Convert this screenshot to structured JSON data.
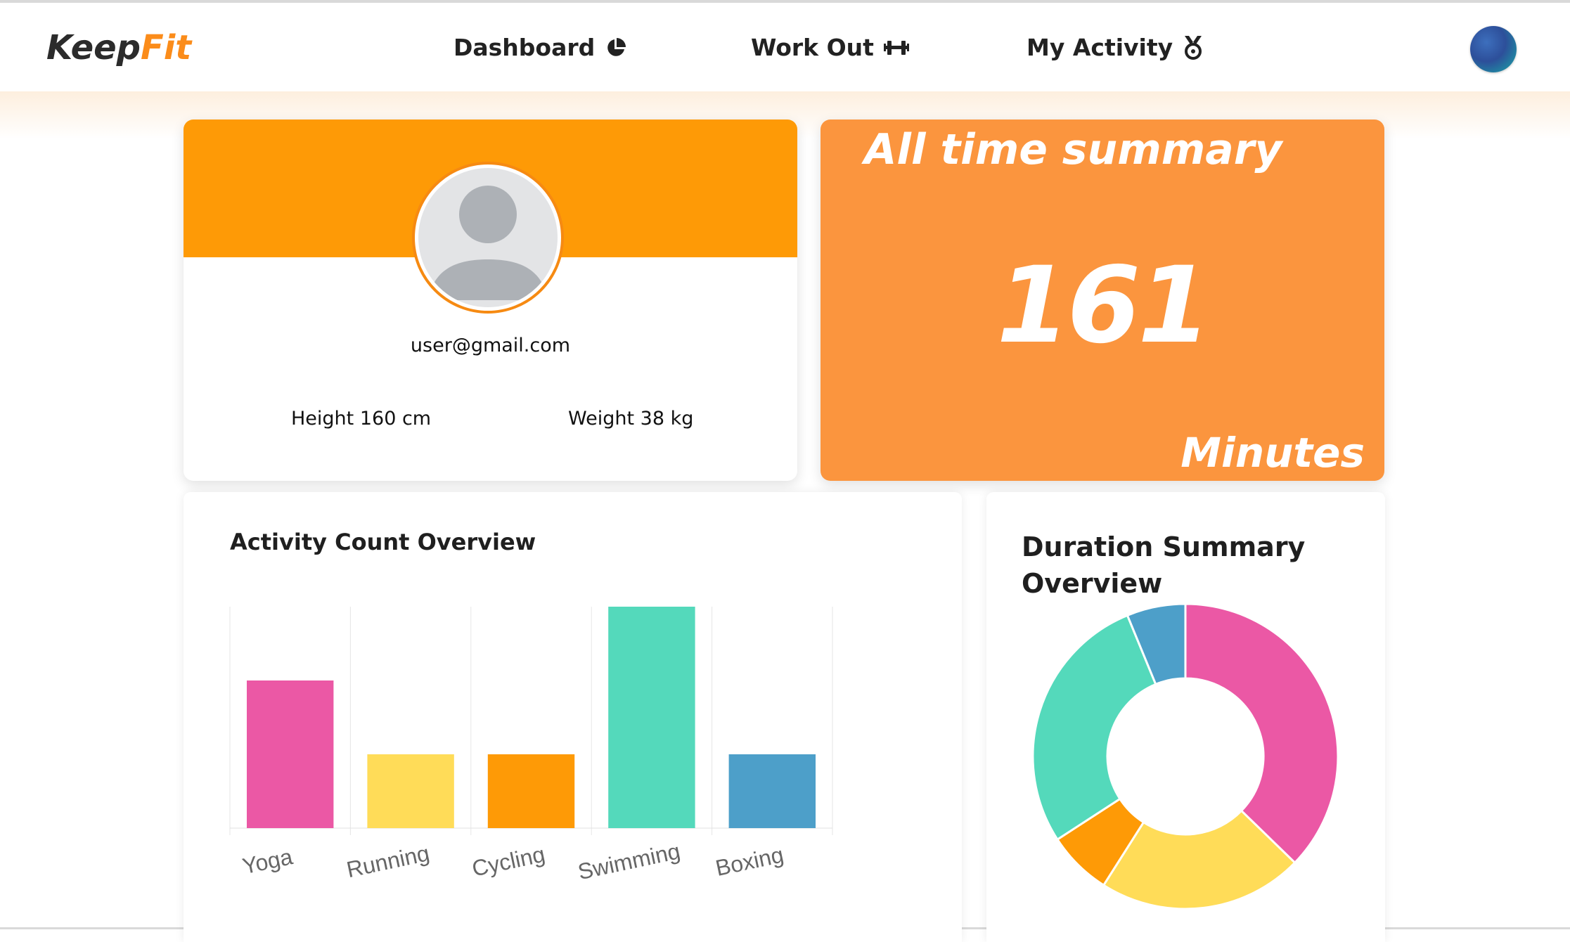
{
  "logo": {
    "part1": "Keep",
    "part2": "Fit"
  },
  "nav": {
    "items": [
      {
        "label": "Dashboard",
        "icon": "pie-chart-icon"
      },
      {
        "label": "Work Out",
        "icon": "dumbbell-icon"
      },
      {
        "label": "My Activity",
        "icon": "medal-icon"
      }
    ],
    "avatar_icon": "user-avatar-icon"
  },
  "profile": {
    "email": "user@gmail.com",
    "height_text": "Height 160 cm",
    "weight_text": "Weight 38 kg",
    "photo_icon": "default-user-photo-icon"
  },
  "summary": {
    "title": "All time summary",
    "value": "161",
    "unit": "Minutes"
  },
  "colors": {
    "orange": "#fe9a06",
    "summary_orange": "#fb953e",
    "pink": "#eb58a5",
    "yellow": "#ffdc58",
    "teal": "#54d9bb",
    "blue": "#4d9fc9",
    "bar_orange": "#fe9a06"
  },
  "activity_chart": {
    "title": "Activity Count Overview",
    "chart_data": {
      "type": "bar",
      "categories": [
        "Yoga",
        "Running",
        "Cycling",
        "Swimming",
        "Boxing"
      ],
      "values": [
        2,
        1,
        1,
        3,
        1
      ],
      "ylim": [
        0,
        3
      ],
      "colors": [
        "#eb58a5",
        "#ffdc58",
        "#fe9a06",
        "#54d9bb",
        "#4d9fc9"
      ],
      "grid": "vertical",
      "legend": "none"
    }
  },
  "duration_chart": {
    "title": "Duration Summary Overview",
    "chart_data": {
      "type": "pie",
      "style": "donut",
      "values": [
        60,
        35,
        11,
        45,
        10
      ],
      "colors": [
        "#eb58a5",
        "#ffdc58",
        "#fe9a06",
        "#54d9bb",
        "#4d9fc9"
      ],
      "legend": "none"
    }
  }
}
